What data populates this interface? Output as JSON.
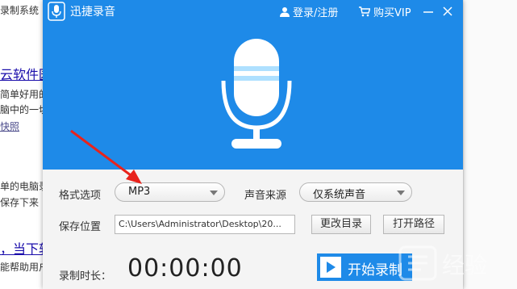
{
  "background": {
    "lines": [
      {
        "text": "录制系统",
        "kind": "text"
      },
      {
        "text": "云软件园",
        "kind": "link"
      },
      {
        "text": "简单好用的",
        "kind": "text"
      },
      {
        "text": "脑中的一切",
        "kind": "text"
      },
      {
        "text": "快照",
        "kind": "small-link"
      },
      {
        "text": "单的电脑录",
        "kind": "text"
      },
      {
        "text": "保存下来",
        "kind": "text"
      },
      {
        "text": "，当下软",
        "kind": "link"
      },
      {
        "text": "能帮助用户",
        "kind": "text"
      }
    ]
  },
  "app": {
    "title": "迅捷录音",
    "login_label": "登录/注册",
    "vip_label": "购买VIP",
    "accent_color": "#1e8ae8"
  },
  "form": {
    "format_label": "格式选项",
    "format_value": "MP3",
    "source_label": "声音来源",
    "source_value": "仅系统声音",
    "save_label": "保存位置",
    "save_path": "C:\\Users\\Administrator\\Desktop\\20...",
    "change_dir_label": "更改目录",
    "open_path_label": "打开路径"
  },
  "recording": {
    "duration_label": "录制时长：",
    "duration_value": "00:00:00",
    "start_label": "开始录制"
  },
  "watermark": {
    "text": "经验"
  }
}
